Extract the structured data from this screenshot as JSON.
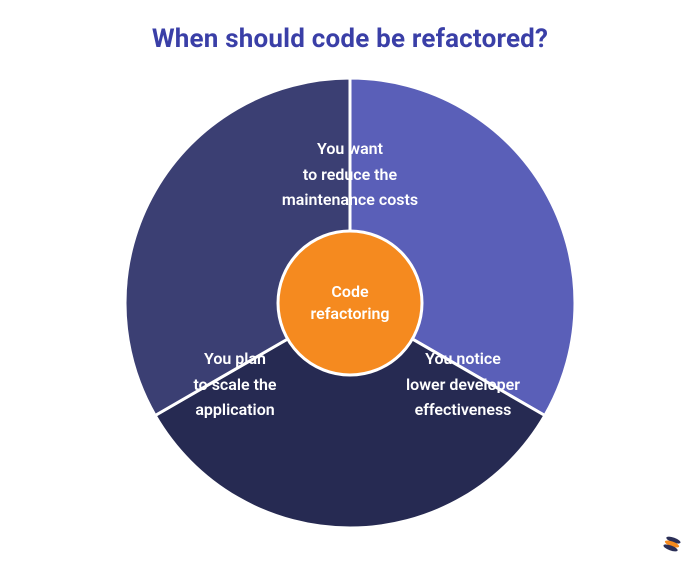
{
  "title": "When should code be refactored?",
  "center": {
    "line1": "Code",
    "line2": "refactoring"
  },
  "slices": {
    "top": {
      "line1": "You want",
      "line2": "to reduce the",
      "line3": "maintenance costs"
    },
    "left": {
      "line1": "You plan",
      "line2": "to scale the",
      "line3": "application"
    },
    "right": {
      "line1": "You notice",
      "line2": "lower developer",
      "line3": "effectiveness"
    }
  },
  "colors": {
    "title": "#3a3fa7",
    "slice_top": "#5a5fb8",
    "slice_left": "#3b3f73",
    "slice_right": "#262a52",
    "center": "#f58a1f",
    "divider": "#ffffff",
    "logo_dark": "#2b2f57",
    "logo_accent": "#f58a1f"
  },
  "chart_data": {
    "type": "pie",
    "title": "When should code be refactored?",
    "categories": [
      "You want to reduce the maintenance costs",
      "You plan to scale the application",
      "You notice lower developer effectiveness"
    ],
    "values": [
      1,
      1,
      1
    ],
    "center_label": "Code refactoring"
  }
}
